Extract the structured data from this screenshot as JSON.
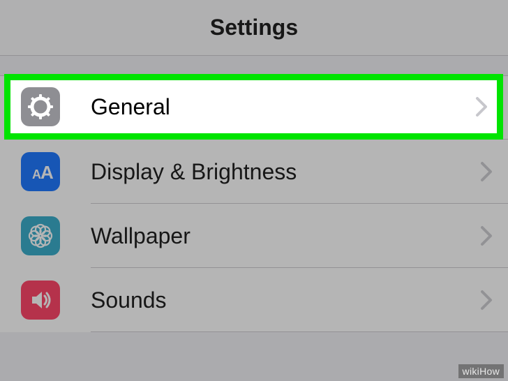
{
  "header": {
    "title": "Settings"
  },
  "rows": {
    "general": {
      "label": "General",
      "icon": "gear-icon"
    },
    "display": {
      "label": "Display & Brightness",
      "icon": "text-size-icon"
    },
    "wallpaper": {
      "label": "Wallpaper",
      "icon": "flower-icon"
    },
    "sounds": {
      "label": "Sounds",
      "icon": "speaker-icon"
    }
  },
  "watermark": "wikiHow",
  "highlight": {
    "target": "general",
    "color": "#00e400"
  }
}
